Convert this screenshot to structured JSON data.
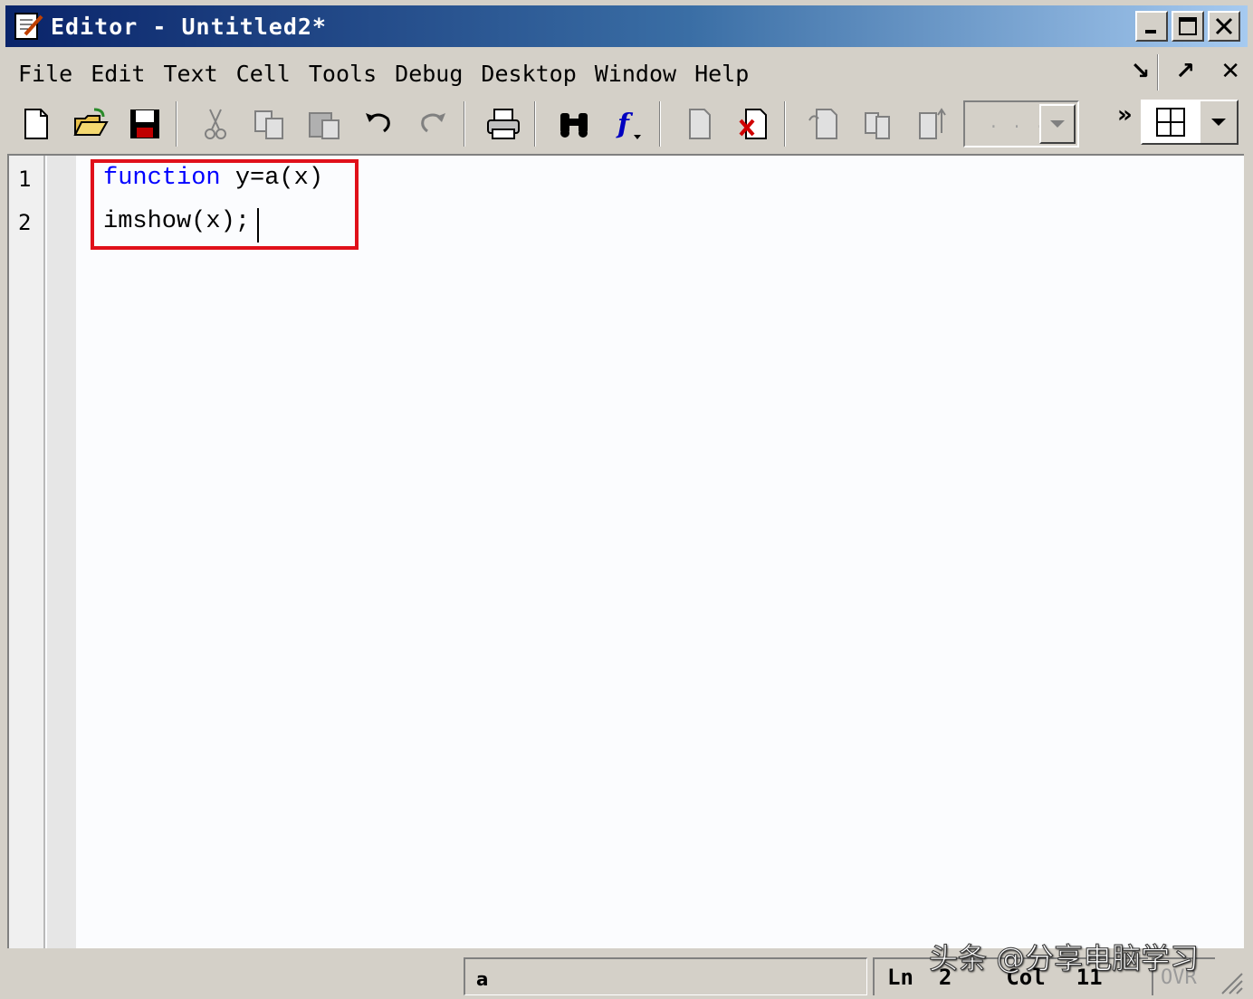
{
  "window": {
    "title": "Editor - Untitled2*",
    "buttons": [
      "minimize",
      "maximize",
      "close"
    ]
  },
  "menu": {
    "items": [
      "File",
      "Edit",
      "Text",
      "Cell",
      "Tools",
      "Debug",
      "Desktop",
      "Window",
      "Help"
    ],
    "right_icons": [
      "undock-icon",
      "maximize-arrow-icon",
      "close-icon"
    ]
  },
  "toolbar": {
    "icons": [
      "new-file-icon",
      "open-folder-icon",
      "save-icon",
      "cut-icon",
      "copy-icon",
      "paste-icon",
      "undo-icon",
      "redo-icon",
      "print-icon",
      "find-icon",
      "function-icon",
      "set-breakpoint-icon",
      "clear-breakpoint-icon",
      "step-icon",
      "step-in-icon",
      "step-out-icon"
    ],
    "stack_combo_value": ". . .",
    "overflow_label": "»",
    "layout_icon": "tile-grid-icon"
  },
  "editor": {
    "lines": [
      {
        "number": "1",
        "keyword": "function",
        "rest": " y=a(x)"
      },
      {
        "number": "2",
        "keyword": "",
        "rest": "imshow(x);"
      }
    ],
    "highlight_color": "#e0101a",
    "keyword_color": "#0000ff"
  },
  "status": {
    "function_name": "a",
    "ln_label": "Ln",
    "ln_value": "2",
    "col_label": "Col",
    "col_value": "11",
    "ovr": "OVR"
  },
  "watermark": "头条 @分享电脑学习"
}
